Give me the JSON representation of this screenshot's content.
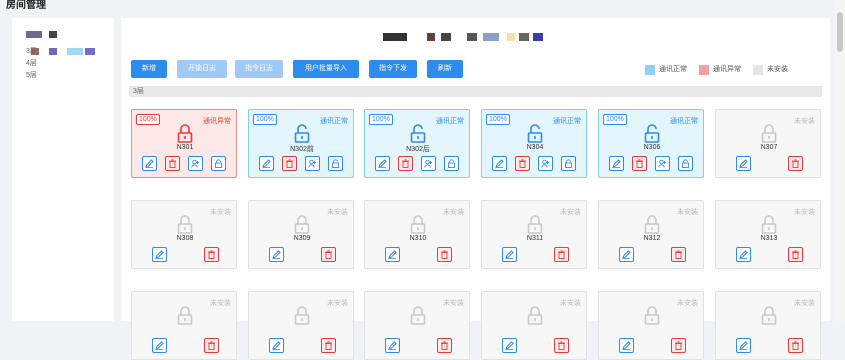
{
  "page_title": "房间管理",
  "sidebar": {
    "floors": [
      "3层",
      "4层",
      "5层"
    ]
  },
  "toolbar": {
    "buttons": [
      {
        "label": "新增",
        "state": "primary"
      },
      {
        "label": "开锁日志",
        "state": "disabled"
      },
      {
        "label": "指令日志",
        "state": "disabled"
      },
      {
        "label": "用户批量导入",
        "state": "primary"
      },
      {
        "label": "指令下发",
        "state": "primary"
      },
      {
        "label": "刷新",
        "state": "primary"
      }
    ]
  },
  "legend": [
    {
      "label": "通讯正常",
      "color": "#8ed3f5"
    },
    {
      "label": "通讯异常",
      "color": "#f4a0a0"
    },
    {
      "label": "未安装",
      "color": "#e4e4e4"
    }
  ],
  "floor_section": {
    "label": "3层"
  },
  "rooms": [
    {
      "name": "N301",
      "status": "通讯异常",
      "state": "err",
      "battery": "100%"
    },
    {
      "name": "N302前",
      "status": "通讯正常",
      "state": "ok",
      "battery": "100%"
    },
    {
      "name": "N302后",
      "status": "通讯正常",
      "state": "ok",
      "battery": "100%"
    },
    {
      "name": "N304",
      "status": "通讯正常",
      "state": "ok",
      "battery": "100%"
    },
    {
      "name": "N306",
      "status": "通讯正常",
      "state": "ok",
      "battery": "100%"
    },
    {
      "name": "N307",
      "status": "未安装",
      "state": "none",
      "battery": ""
    },
    {
      "name": "N308",
      "status": "未安装",
      "state": "none",
      "battery": ""
    },
    {
      "name": "N309",
      "status": "未安装",
      "state": "none",
      "battery": ""
    },
    {
      "name": "N310",
      "status": "未安装",
      "state": "none",
      "battery": ""
    },
    {
      "name": "N311",
      "status": "未安装",
      "state": "none",
      "battery": ""
    },
    {
      "name": "N312",
      "status": "未安装",
      "state": "none",
      "battery": ""
    },
    {
      "name": "N313",
      "status": "未安装",
      "state": "none",
      "battery": ""
    },
    {
      "name": "",
      "status": "未安装",
      "state": "none",
      "battery": ""
    },
    {
      "name": "",
      "status": "未安装",
      "state": "none",
      "battery": ""
    },
    {
      "name": "",
      "status": "未安装",
      "state": "none",
      "battery": ""
    },
    {
      "name": "",
      "status": "未安装",
      "state": "none",
      "battery": ""
    },
    {
      "name": "",
      "status": "未安装",
      "state": "none",
      "battery": ""
    },
    {
      "name": "",
      "status": "未安装",
      "state": "none",
      "battery": ""
    }
  ]
}
